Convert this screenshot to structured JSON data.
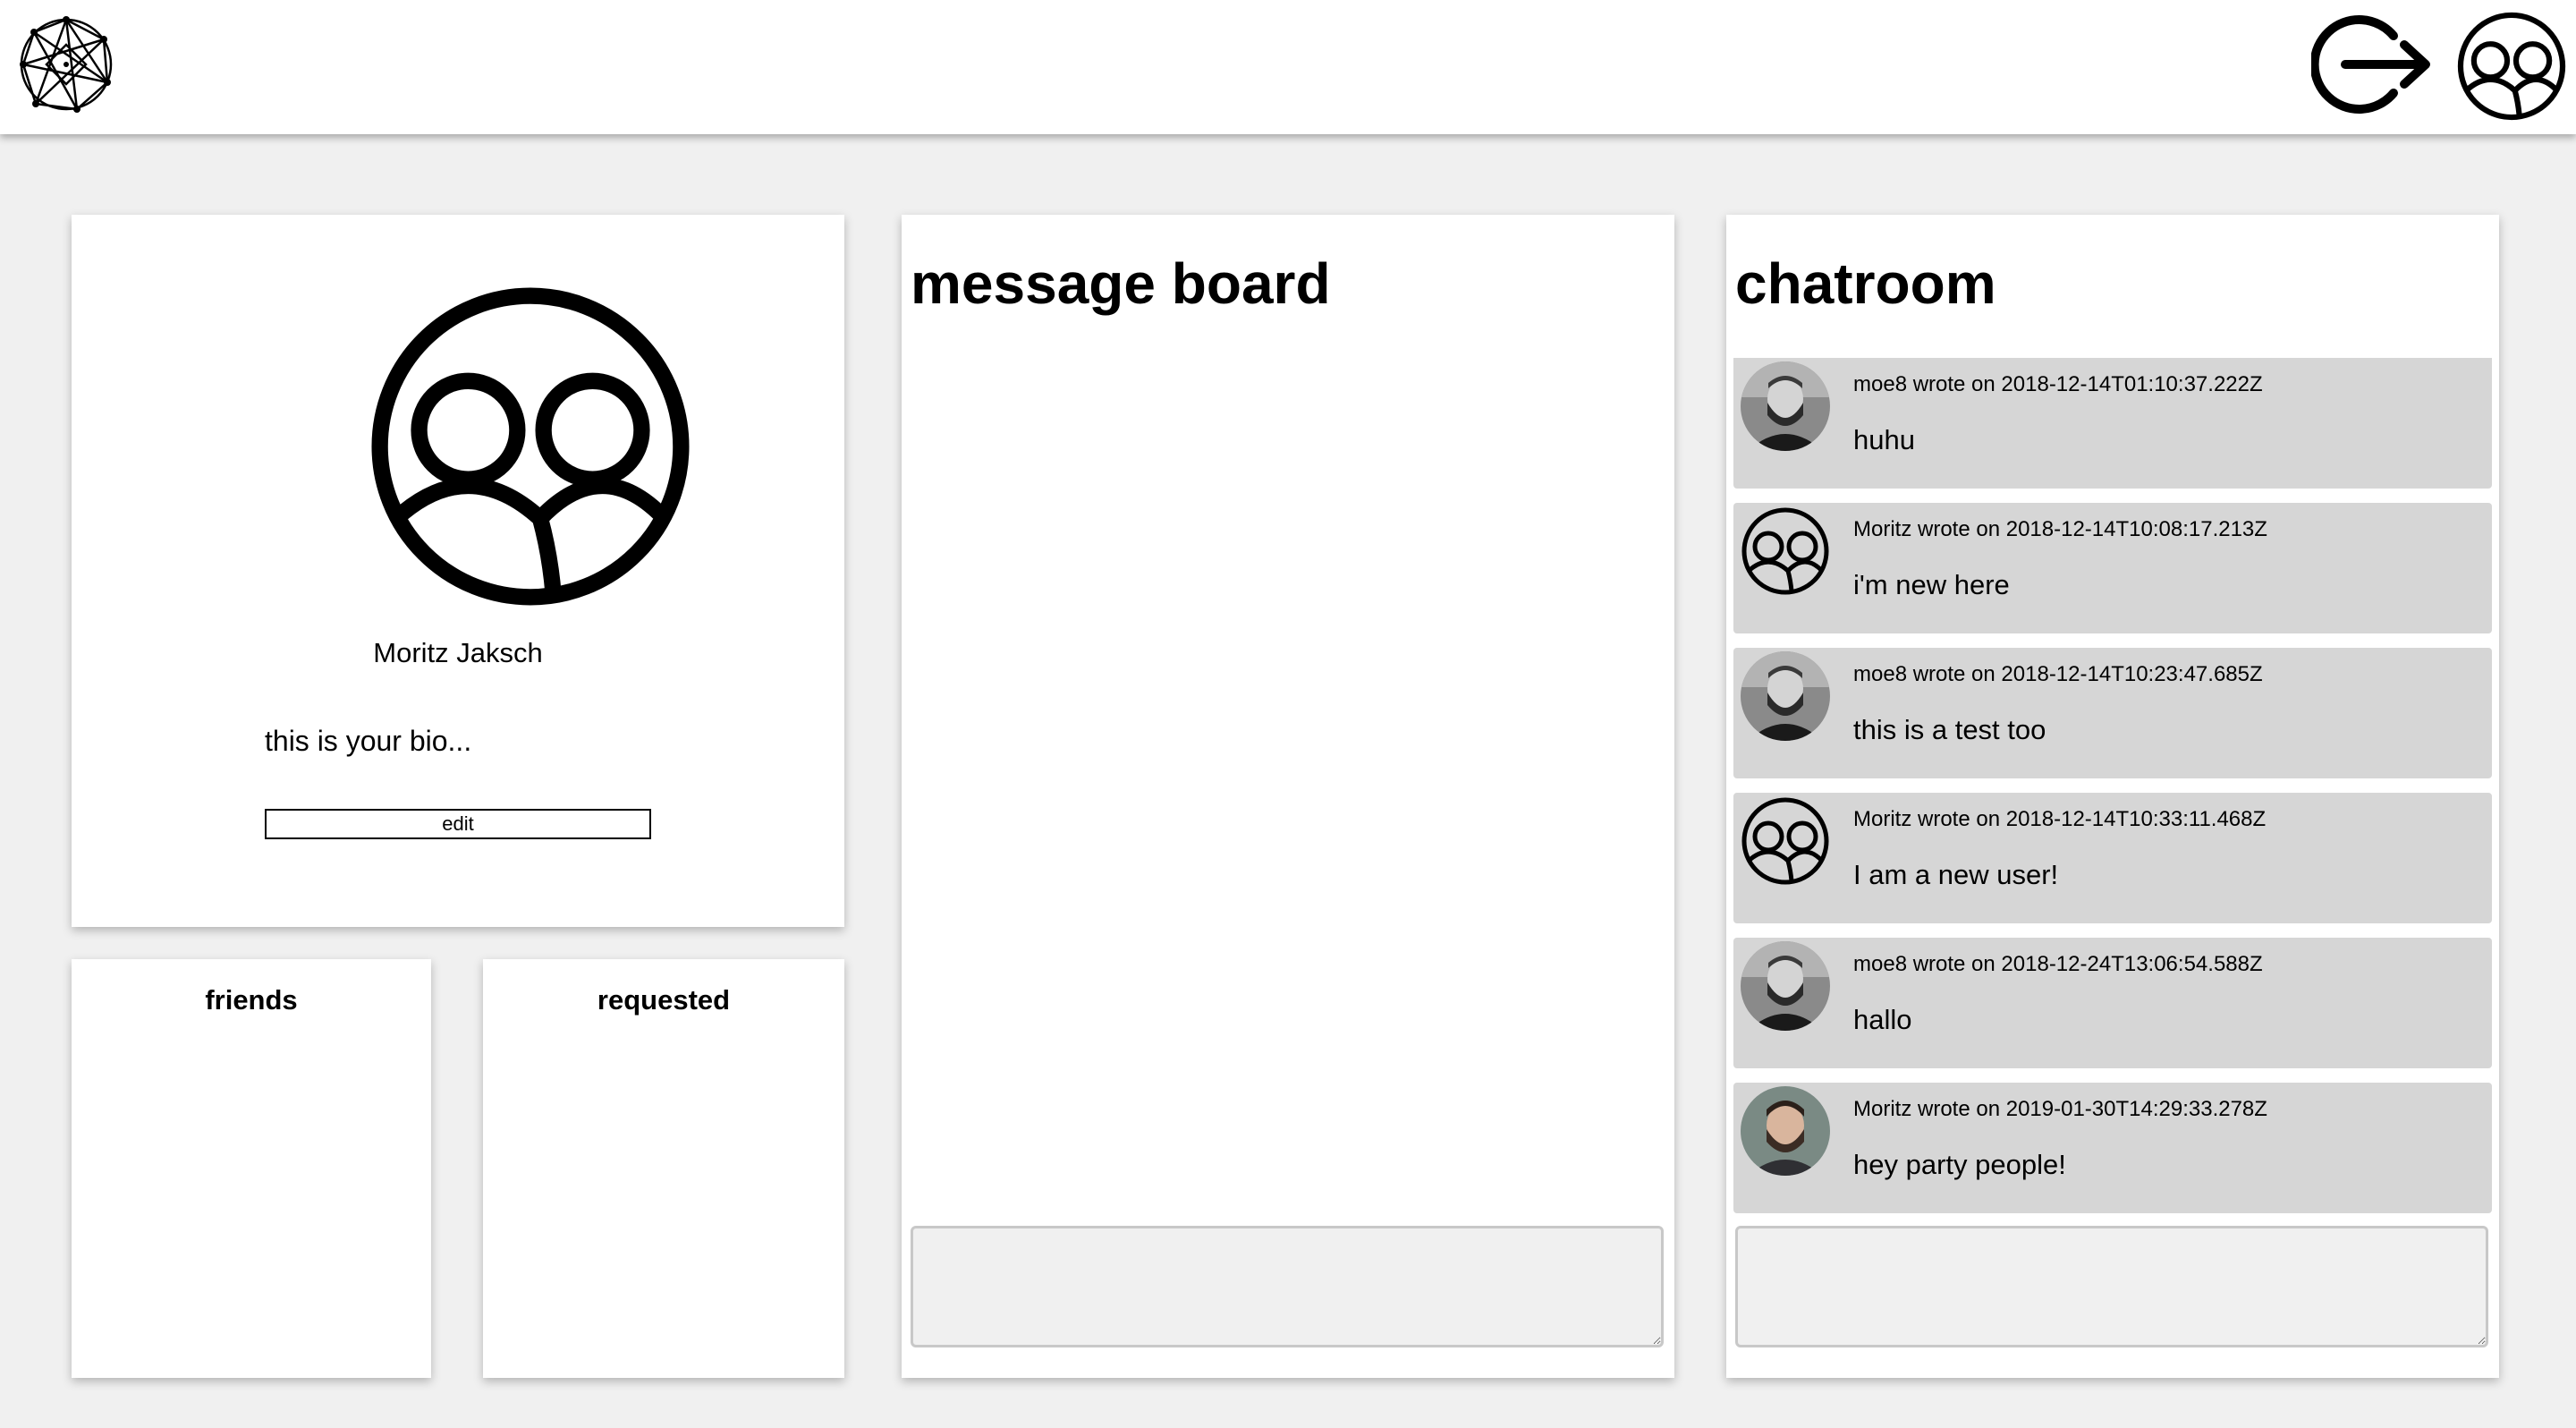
{
  "header": {
    "logo_icon": "network-globe-icon",
    "logout_icon": "logout-arrow-icon",
    "profile_icon": "users-group-icon"
  },
  "profile": {
    "avatar_icon": "users-group-icon",
    "name": "Moritz Jaksch",
    "bio": "this is your bio...",
    "edit_label": "edit"
  },
  "friends": {
    "title": "friends"
  },
  "requested": {
    "title": "requested"
  },
  "message_board": {
    "title": "message board",
    "input_value": ""
  },
  "chatroom": {
    "title": "chatroom",
    "input_value": "",
    "messages": [
      {
        "meta": "moe8 wrote on 2018-12-14T01:10:37.222Z",
        "text": "huhu",
        "avatar": "photo-gray-bearded-man"
      },
      {
        "meta": "Moritz wrote on 2018-12-14T10:08:17.213Z",
        "text": "i'm new here",
        "avatar": "users-group-icon"
      },
      {
        "meta": "moe8 wrote on 2018-12-14T10:23:47.685Z",
        "text": "this is a test too",
        "avatar": "photo-gray-bearded-man"
      },
      {
        "meta": "Moritz wrote on 2018-12-14T10:33:11.468Z",
        "text": "I am a new user!",
        "avatar": "users-group-icon"
      },
      {
        "meta": "moe8 wrote on 2018-12-24T13:06:54.588Z",
        "text": "hallo",
        "avatar": "photo-gray-bearded-man"
      },
      {
        "meta": "Moritz wrote on 2019-01-30T14:29:33.278Z",
        "text": "hey party people!",
        "avatar": "photo-color-bearded-man"
      }
    ]
  }
}
